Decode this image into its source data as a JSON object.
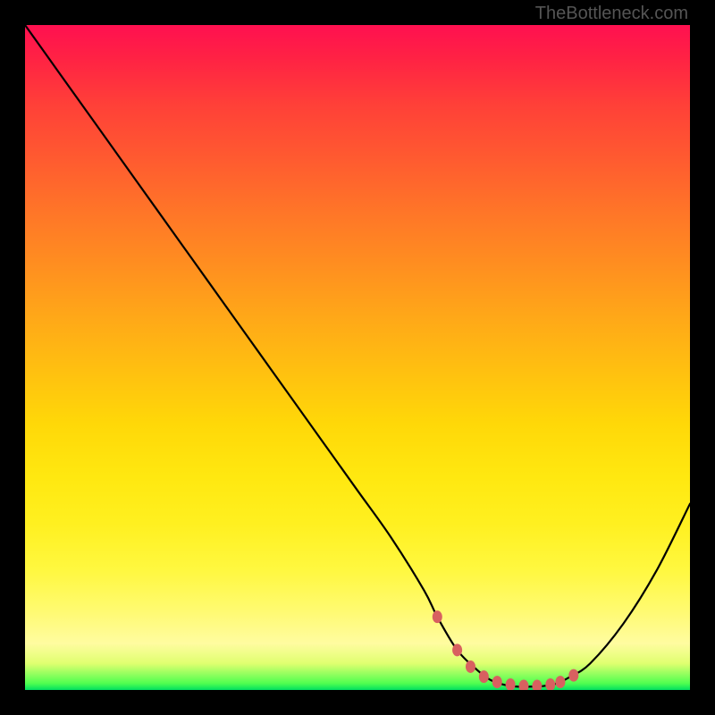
{
  "watermark": "TheBottleneck.com",
  "chart_data": {
    "type": "line",
    "title": "",
    "xlabel": "",
    "ylabel": "",
    "xlim": [
      0,
      100
    ],
    "ylim": [
      0,
      100
    ],
    "series": [
      {
        "name": "bottleneck-curve",
        "x": [
          0,
          5,
          10,
          15,
          20,
          25,
          30,
          35,
          40,
          45,
          50,
          55,
          60,
          62,
          65,
          68,
          70,
          72,
          74,
          76,
          78,
          80,
          82,
          85,
          90,
          95,
          100
        ],
        "values": [
          100,
          93,
          86,
          79,
          72,
          65,
          58,
          51,
          44,
          37,
          30,
          23,
          15,
          11,
          6,
          3,
          1.5,
          0.8,
          0.5,
          0.5,
          0.6,
          1,
          2,
          4,
          10,
          18,
          28
        ]
      }
    ],
    "markers": {
      "name": "optimal-range-markers",
      "color": "#d86060",
      "points_x": [
        62,
        65,
        67,
        69,
        71,
        73,
        75,
        77,
        79,
        80.5,
        82.5
      ],
      "points_y": [
        11,
        6,
        3.5,
        2,
        1.2,
        0.8,
        0.6,
        0.6,
        0.8,
        1.2,
        2.2
      ]
    },
    "gradient": {
      "type": "vertical",
      "stops": [
        {
          "pos": 0,
          "color": "#ff1050"
        },
        {
          "pos": 50,
          "color": "#ffc010"
        },
        {
          "pos": 90,
          "color": "#fffca0"
        },
        {
          "pos": 100,
          "color": "#00e060"
        }
      ]
    }
  }
}
